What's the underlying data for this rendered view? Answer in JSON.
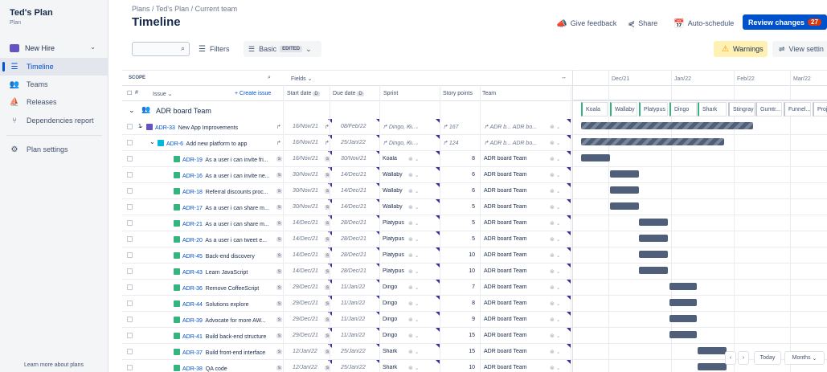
{
  "sidebar": {
    "plan_title": "Ted's Plan",
    "plan_sub": "Plan",
    "scenario": "New Hire",
    "items": [
      {
        "label": "Timeline"
      },
      {
        "label": "Teams"
      },
      {
        "label": "Releases"
      },
      {
        "label": "Dependencies report"
      }
    ],
    "settings": "Plan settings",
    "learn": "Learn more about plans"
  },
  "header": {
    "breadcrumb": "Plans  /  Ted's Plan  /  Current team",
    "title": "Timeline",
    "feedback": "Give feedback",
    "share": "Share",
    "autoschedule": "Auto-schedule",
    "review": "Review changes",
    "review_count": "27"
  },
  "toolbar": {
    "filters": "Filters",
    "basic": "Basic",
    "edited": "EDITED",
    "warnings": "Warnings",
    "view_settings": "View settin"
  },
  "table": {
    "scope": "SCOPE",
    "fields": "Fields",
    "hash": "#",
    "issue": "Issue",
    "create": "+ Create issue",
    "start": "Start date",
    "due": "Due date",
    "sprint": "Sprint",
    "points": "Story points",
    "team": "Team",
    "team_group": "ADR board Team",
    "rows": [
      {
        "n": "1",
        "key": "ADR-33",
        "title": "New App Improvements",
        "start": "16/Nov/21",
        "due": "08/Feb/22",
        "sprint": "Dingo, K...",
        "points": "167",
        "team": "ADR b...  ADR bo..."
      },
      {
        "n": "",
        "key": "ADR-6",
        "title": "Add new platform to app",
        "start": "16/Nov/21",
        "due": "25/Jan/22",
        "sprint": "Dingo, K...",
        "points": "124",
        "team": "ADR b...  ADR bo..."
      },
      {
        "n": "",
        "key": "ADR-19",
        "title": "As a user i can invite fri...",
        "start": "16/Nov/21",
        "due": "30/Nov/21",
        "sprint": "Koala",
        "points": "8",
        "team": "ADR board Team"
      },
      {
        "n": "",
        "key": "ADR-16",
        "title": "As a user i can invite ne...",
        "start": "30/Nov/21",
        "due": "14/Dec/21",
        "sprint": "Wallaby",
        "points": "6",
        "team": "ADR board Team"
      },
      {
        "n": "",
        "key": "ADR-18",
        "title": "Referral discounts proc...",
        "start": "30/Nov/21",
        "due": "14/Dec/21",
        "sprint": "Wallaby",
        "points": "6",
        "team": "ADR board Team"
      },
      {
        "n": "",
        "key": "ADR-17",
        "title": "As a user i can share m...",
        "start": "30/Nov/21",
        "due": "14/Dec/21",
        "sprint": "Wallaby",
        "points": "5",
        "team": "ADR board Team"
      },
      {
        "n": "",
        "key": "ADR-21",
        "title": "As a user i can share m...",
        "start": "14/Dec/21",
        "due": "28/Dec/21",
        "sprint": "Platypus",
        "points": "5",
        "team": "ADR board Team"
      },
      {
        "n": "",
        "key": "ADR-20",
        "title": "As a user i can tweet e...",
        "start": "14/Dec/21",
        "due": "28/Dec/21",
        "sprint": "Platypus",
        "points": "5",
        "team": "ADR board Team"
      },
      {
        "n": "",
        "key": "ADR-45",
        "title": "Back-end discovery",
        "start": "14/Dec/21",
        "due": "28/Dec/21",
        "sprint": "Platypus",
        "points": "10",
        "team": "ADR board Team"
      },
      {
        "n": "",
        "key": "ADR-43",
        "title": "Learn JavaScript",
        "start": "14/Dec/21",
        "due": "28/Dec/21",
        "sprint": "Platypus",
        "points": "10",
        "team": "ADR board Team"
      },
      {
        "n": "",
        "key": "ADR-36",
        "title": "Remove CoffeeScript",
        "start": "29/Dec/21",
        "due": "11/Jan/22",
        "sprint": "Dingo",
        "points": "7",
        "team": "ADR board Team"
      },
      {
        "n": "",
        "key": "ADR-44",
        "title": "Solutions explore",
        "start": "29/Dec/21",
        "due": "11/Jan/22",
        "sprint": "Dingo",
        "points": "8",
        "team": "ADR board Team"
      },
      {
        "n": "",
        "key": "ADR-39",
        "title": "Advocate for more AW...",
        "start": "29/Dec/21",
        "due": "11/Jan/22",
        "sprint": "Dingo",
        "points": "9",
        "team": "ADR board Team"
      },
      {
        "n": "",
        "key": "ADR-41",
        "title": "Build back-end structure",
        "start": "29/Dec/21",
        "due": "11/Jan/22",
        "sprint": "Dingo",
        "points": "15",
        "team": "ADR board Team"
      },
      {
        "n": "",
        "key": "ADR-37",
        "title": "Build front-end interface",
        "start": "12/Jan/22",
        "due": "25/Jan/22",
        "sprint": "Shark",
        "points": "15",
        "team": "ADR board Team"
      },
      {
        "n": "",
        "key": "ADR-38",
        "title": "QA code",
        "start": "12/Jan/22",
        "due": "25/Jan/22",
        "sprint": "Shark",
        "points": "10",
        "team": "ADR board Team"
      }
    ]
  },
  "timeline": {
    "months": [
      "Dec/21",
      "Jan/22",
      "Feb/22",
      "Mar/22"
    ],
    "sprints": [
      "Koala",
      "Wallaby",
      "Platypus",
      "Dingo",
      "Shark",
      "Stingray",
      "Gumtr...",
      "Funnel...",
      "Proj"
    ],
    "today": "Today",
    "months_btn": "Months"
  }
}
